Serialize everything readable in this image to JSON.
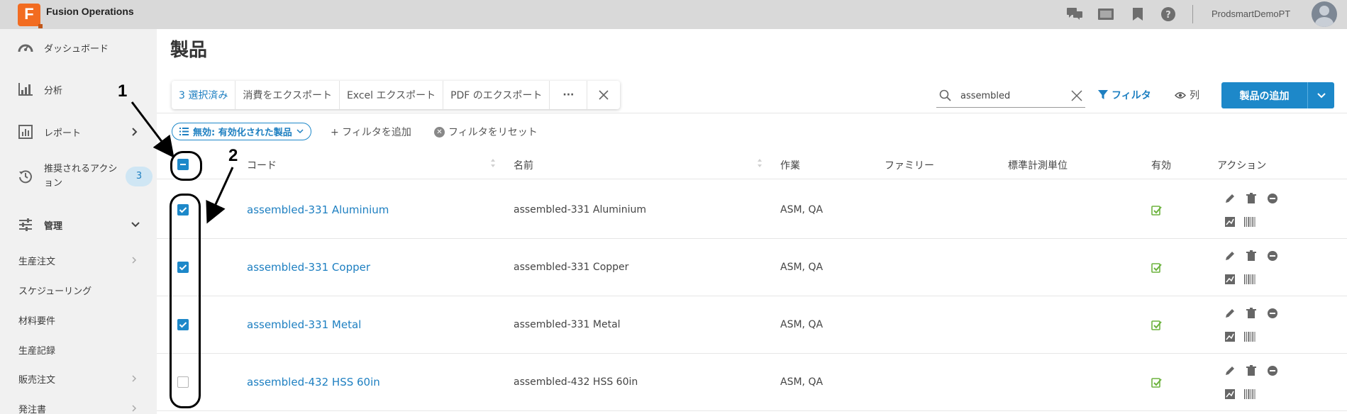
{
  "app": {
    "title": "Fusion Operations",
    "logo_letter": "F",
    "user": "ProdsmartDemoPT"
  },
  "topbar_icons": [
    "chat-icon",
    "monitor-icon",
    "bookmark-icon",
    "help-icon"
  ],
  "sidebar": {
    "items": [
      {
        "label": "ダッシュボード",
        "icon": "speedometer-icon"
      },
      {
        "label": "分析",
        "icon": "bar-chart-icon"
      },
      {
        "label": "レポート",
        "icon": "report-icon"
      },
      {
        "label": "推奨されるアクション",
        "badge": "3",
        "icon": "history-icon"
      },
      {
        "label": "管理",
        "icon": "sliders-icon"
      }
    ],
    "sub_items": [
      "生産注文",
      "スケジューリング",
      "材料要件",
      "生産記録",
      "販売注文",
      "発注書"
    ]
  },
  "page_title": "製品",
  "bulk_bar": {
    "selected": "3 選択済み",
    "export_consumption": "消費をエクスポート",
    "export_excel": "Excel エクスポート",
    "export_pdf": "PDF のエクスポート",
    "more": "···"
  },
  "search": {
    "value": "assembled"
  },
  "toolbar": {
    "filter_label": "フィルタ",
    "columns_label": "列",
    "add_label": "製品の追加"
  },
  "filters": {
    "chip_label": "無効: 有効化された製品",
    "add_filter": "+ フィルタを追加",
    "reset_filter": "フィルタをリセット"
  },
  "table": {
    "headers": {
      "code": "コード",
      "name": "名前",
      "operations": "作業",
      "family": "ファミリー",
      "unit": "標準計測単位",
      "active": "有効",
      "actions": "アクション"
    },
    "rows": [
      {
        "code": "assembled-331 Aluminium",
        "name": "assembled-331 Aluminium",
        "operations": "ASM, QA",
        "family": "",
        "unit": "",
        "checked": true,
        "active": true
      },
      {
        "code": "assembled-331 Copper",
        "name": "assembled-331 Copper",
        "operations": "ASM, QA",
        "family": "",
        "unit": "",
        "checked": true,
        "active": true
      },
      {
        "code": "assembled-331 Metal",
        "name": "assembled-331 Metal",
        "operations": "ASM, QA",
        "family": "",
        "unit": "",
        "checked": true,
        "active": true
      },
      {
        "code": "assembled-432 HSS 60in",
        "name": "assembled-432 HSS 60in",
        "operations": "ASM, QA",
        "family": "",
        "unit": "",
        "checked": false,
        "active": true
      }
    ]
  },
  "annotations": {
    "label1": "1",
    "label2": "2"
  },
  "colors": {
    "accent": "#1d88c9",
    "logo": "#f26c21",
    "active_check": "#6db33f"
  }
}
